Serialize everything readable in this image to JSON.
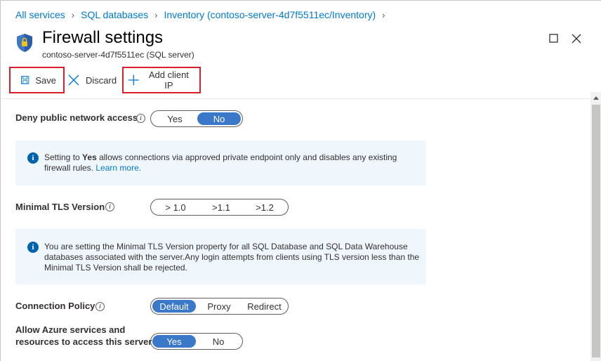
{
  "breadcrumb": {
    "items": [
      "All services",
      "SQL databases",
      "Inventory (contoso-server-4d7f5511ec/Inventory)"
    ]
  },
  "header": {
    "title": "Firewall settings",
    "subtitle": "contoso-server-4d7f5511ec (SQL server)",
    "icon": "shield-icon"
  },
  "toolbar": {
    "save_label": "Save",
    "discard_label": "Discard",
    "add_client_ip_label": "Add client IP"
  },
  "deny_public": {
    "label": "Deny public network access",
    "options": [
      "Yes",
      "No"
    ],
    "selected": "No"
  },
  "deny_info": {
    "prefix": "Setting to ",
    "bold": "Yes",
    "line1_rest": " allows connections via approved private endpoint only and disables any existing",
    "line2": "firewall rules.",
    "link": "Learn more."
  },
  "tls": {
    "label": "Minimal TLS Version",
    "options": [
      "> 1.0",
      ">1.1",
      ">1.2"
    ],
    "selected": null
  },
  "tls_info": {
    "line1": "You are setting the Minimal TLS Version property for all SQL Database and SQL Data Warehouse",
    "line2": "databases associated with the server.Any login attempts from clients using TLS version less than the",
    "line3": "Minimal TLS Version shall be rejected."
  },
  "connection_policy": {
    "label": "Connection Policy",
    "options": [
      "Default",
      "Proxy",
      "Redirect"
    ],
    "selected": "Default"
  },
  "allow_azure": {
    "label_line1": "Allow Azure services and",
    "label_line2": "resources to access this server",
    "options": [
      "Yes",
      "No"
    ],
    "selected": "Yes"
  },
  "colors": {
    "accent": "#0078d4",
    "toggle_on": "#3a78c9",
    "highlight": "#d8202a",
    "info_bg": "#eff6fc"
  }
}
